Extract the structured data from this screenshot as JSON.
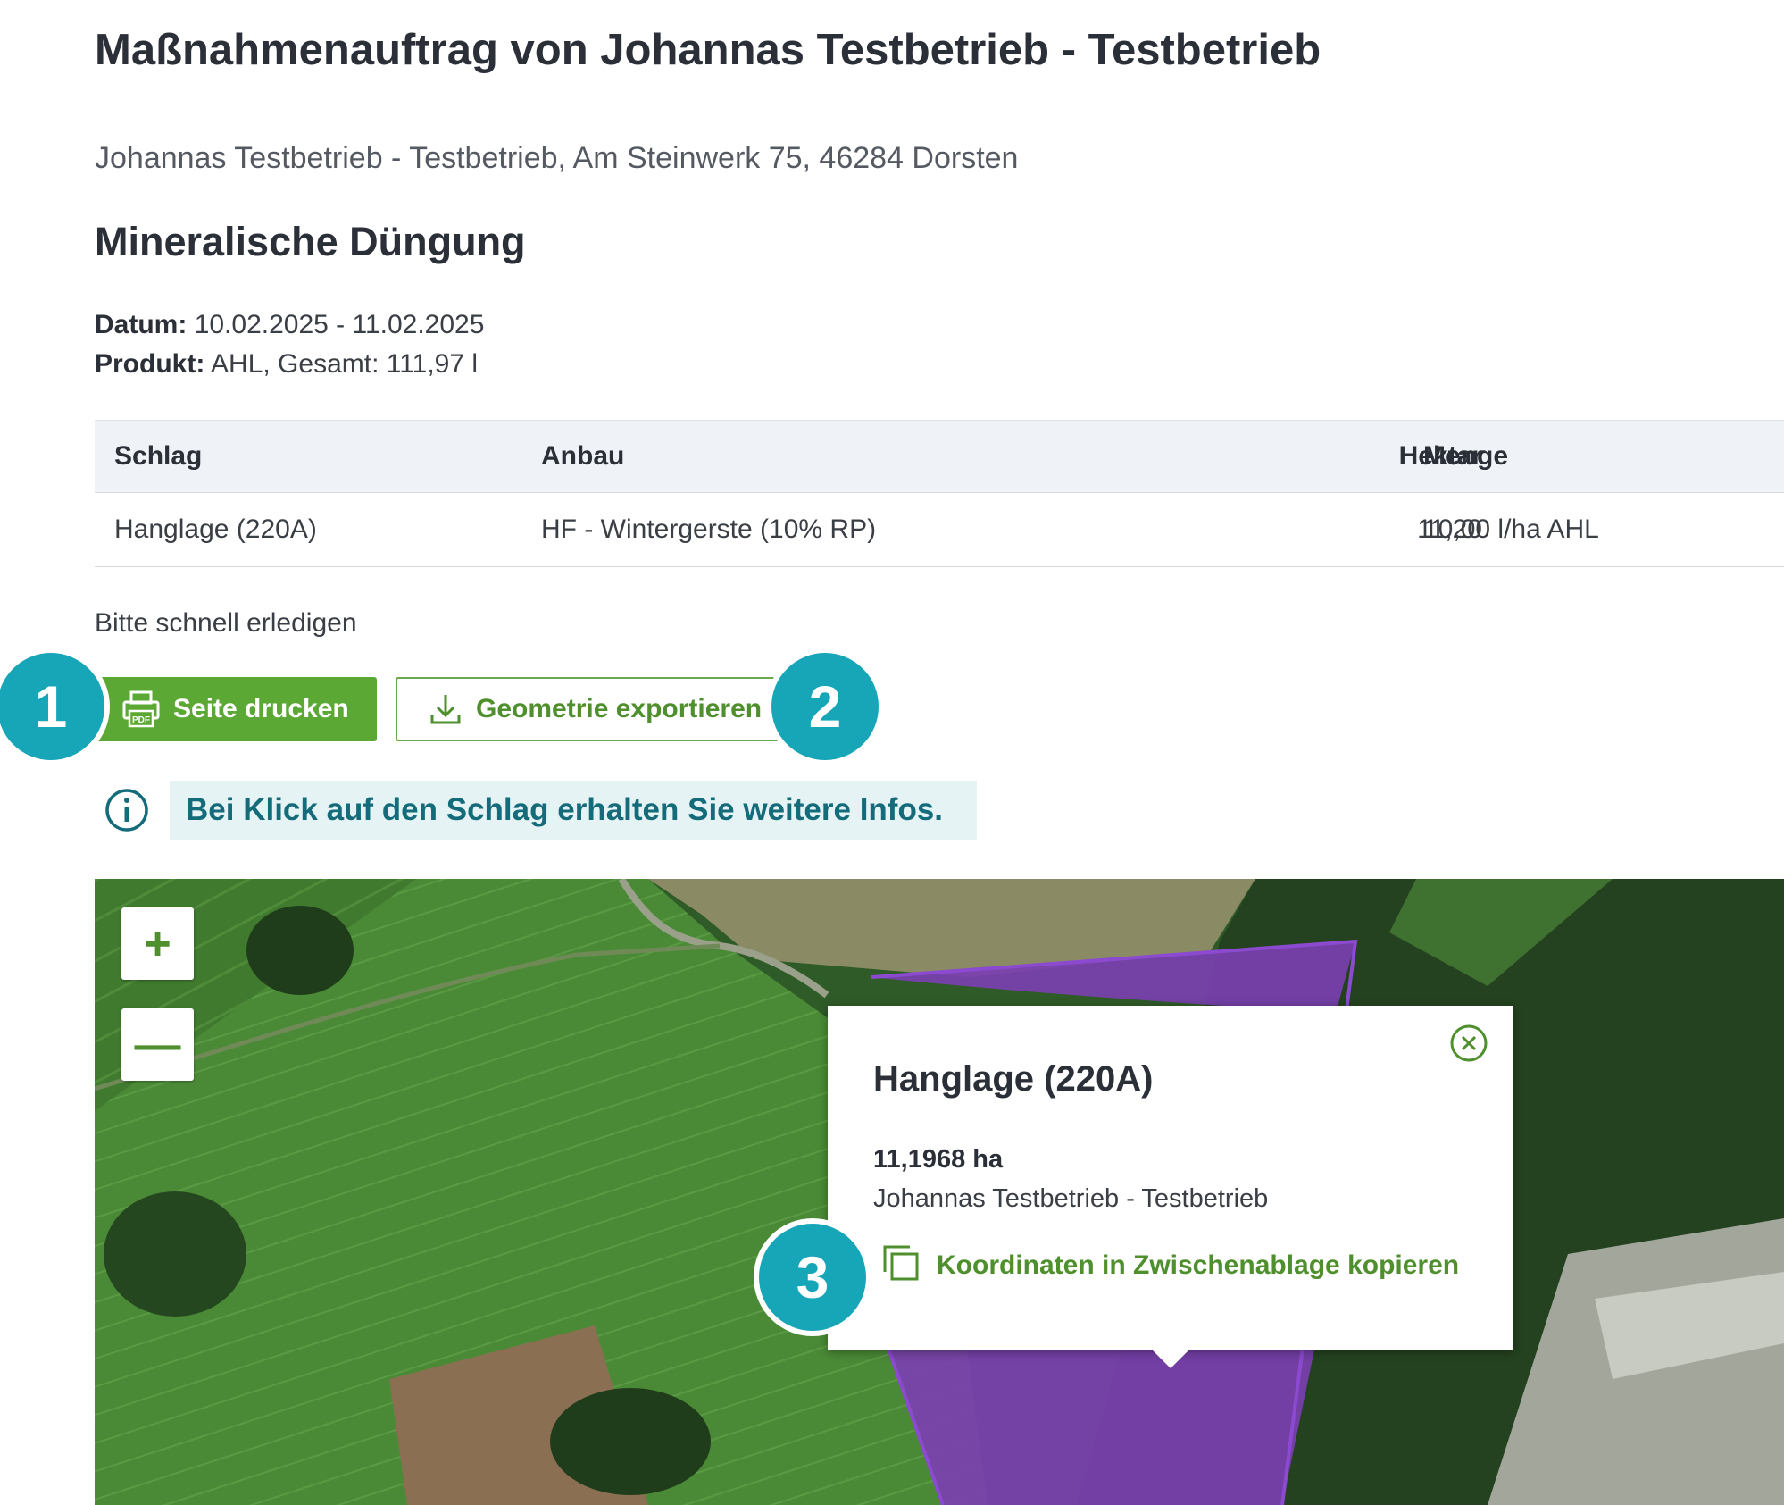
{
  "page": {
    "title": "Maßnahmenauftrag von Johannas Testbetrieb - Testbetrieb",
    "address": "Johannas Testbetrieb - Testbetrieb, Am Steinwerk 75, 46284 Dorsten"
  },
  "section": {
    "title": "Mineralische Düngung",
    "date_label": "Datum:",
    "date_value": "10.02.2025 - 11.02.2025",
    "product_label": "Produkt:",
    "product_value": "AHL, Gesamt: 111,97 l"
  },
  "table": {
    "headers": [
      "Schlag",
      "Anbau",
      "Hektar",
      "Menge"
    ],
    "rows": [
      [
        "Hanglage (220A)",
        "HF - Wintergerste (10% RP)",
        "11,20",
        "10,00 l/ha AHL"
      ]
    ]
  },
  "note": "Bitte schnell erledigen",
  "actions": {
    "print_label": "Seite drucken",
    "export_label": "Geometrie exportieren",
    "pdf_icon_text": "PDF"
  },
  "badges": [
    "1",
    "2",
    "3"
  ],
  "info": {
    "text": "Bei Klick auf den Schlag erhalten Sie weitere Infos."
  },
  "map": {
    "zoom_in": "+",
    "zoom_out": "—",
    "field_color": "#7b3fb0",
    "popup": {
      "title": "Hanglage (220A)",
      "area": "11,1968 ha",
      "farm": "Johannas Testbetrieb - Testbetrieb",
      "copy_label": "Koordinaten in Zwischenablage kopieren"
    }
  },
  "colors": {
    "primary_green": "#5ba834",
    "link_green": "#4f8f2d",
    "badge_teal": "#17a5b8",
    "info_teal": "#146b7a",
    "info_bg": "#e5f3f5"
  },
  "icons": [
    "pdf-print-icon",
    "download-icon",
    "info-icon",
    "close-circle-icon",
    "copy-icon"
  ]
}
